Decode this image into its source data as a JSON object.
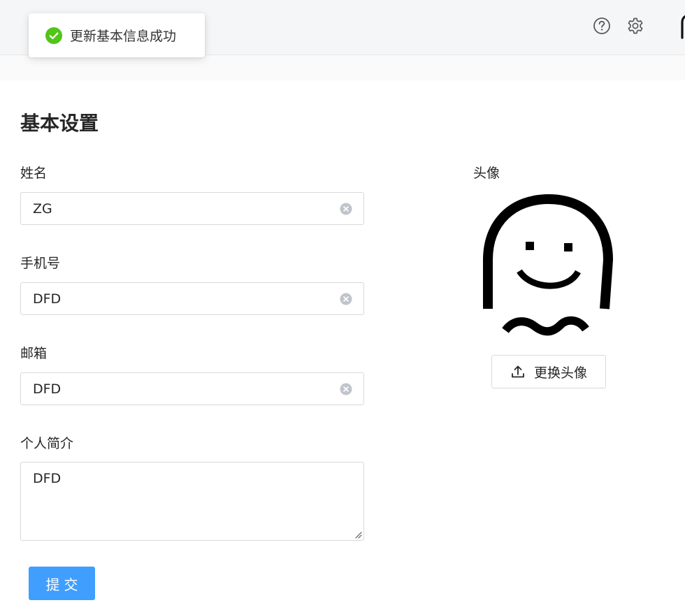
{
  "toast": {
    "message": "更新基本信息成功",
    "icon": "success-check-icon",
    "color": "#52c41a"
  },
  "header": {
    "help_icon": "question-circle-icon",
    "settings_icon": "gear-icon"
  },
  "page": {
    "title": "基本设置"
  },
  "form": {
    "name_label": "姓名",
    "name_value": "ZG",
    "phone_label": "手机号",
    "phone_value": "DFD",
    "email_label": "邮箱",
    "email_value": "DFD",
    "bio_label": "个人简介",
    "bio_value": "DFD",
    "submit_label": "提交",
    "submit_color": "#409eff"
  },
  "avatar": {
    "label": "头像",
    "change_label": "更换头像",
    "upload_icon": "upload-icon"
  }
}
